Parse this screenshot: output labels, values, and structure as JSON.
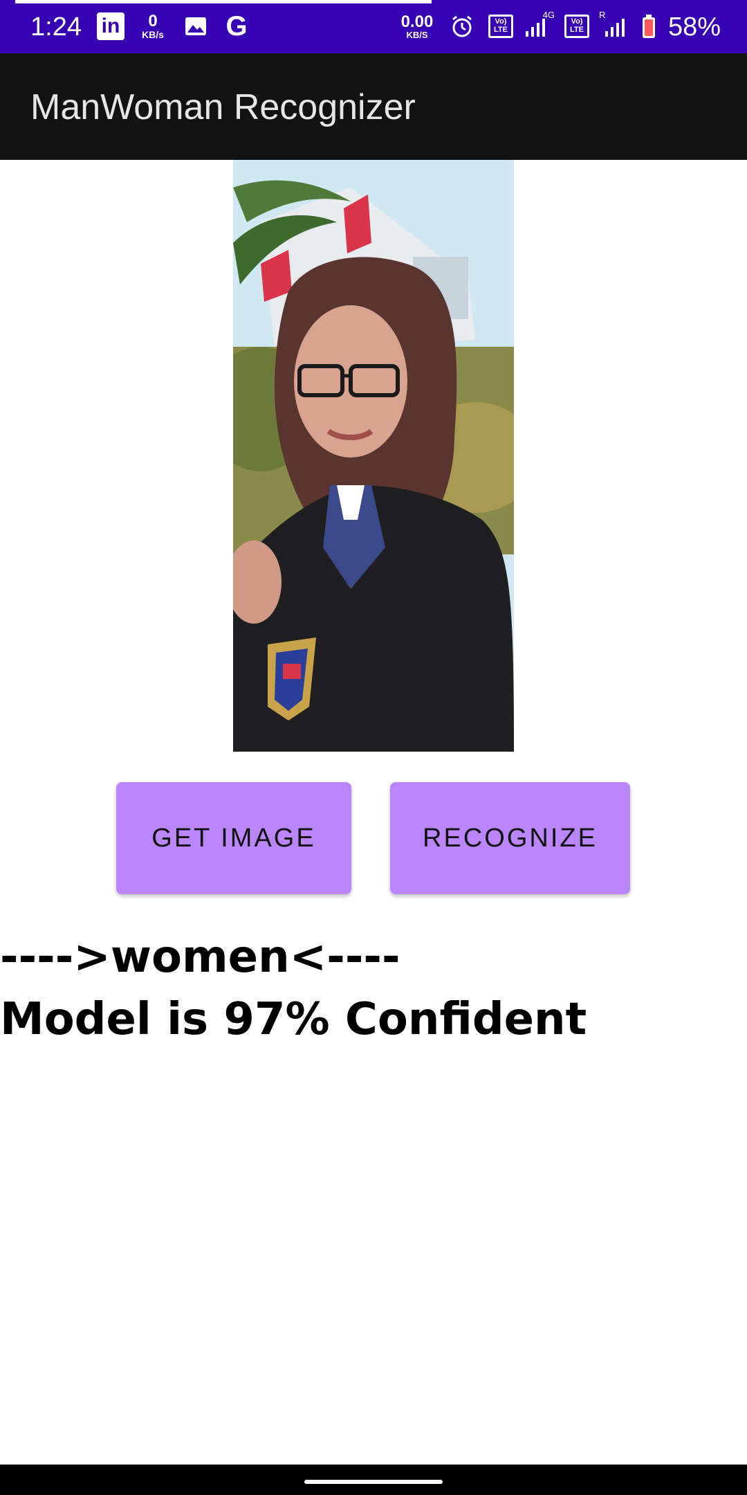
{
  "status_bar": {
    "time": "1:24",
    "net_speed_left": {
      "value": "0",
      "unit": "KB/s"
    },
    "net_speed_right": {
      "value": "0.00",
      "unit": "KB/S"
    },
    "battery": "58%",
    "lte_label_top": "Vo)",
    "lte_label_bottom": "LTE",
    "sig1_label": "4G",
    "sig2_label": "R",
    "icons": [
      "linkedin-icon",
      "gallery-icon",
      "google-icon",
      "alarm-icon",
      "volte-icon",
      "signal-icon",
      "battery-icon"
    ],
    "color": "#3700b3"
  },
  "app_bar": {
    "title": "ManWoman Recognizer",
    "color": "#121212"
  },
  "buttons": {
    "get_image": "GET IMAGE",
    "recognize": "RECOGNIZE",
    "color": "#bb86fc"
  },
  "result": {
    "line1": "---->women<----",
    "line2": "Model is 97% Confident"
  }
}
